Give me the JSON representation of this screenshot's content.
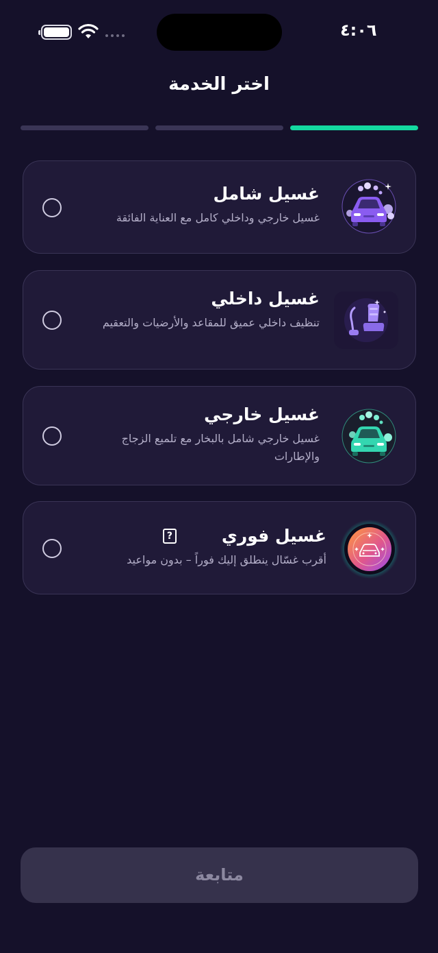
{
  "status_bar": {
    "time": "٤:٠٦"
  },
  "header": {
    "title": "اختر الخدمة"
  },
  "progress": {
    "current_step": 3,
    "total_steps": 3,
    "accent_color": "#14d9a0"
  },
  "services": [
    {
      "name": "غسيل شامل",
      "description": "غسيل خارجي وداخلي كامل مع العناية الفائقة",
      "icon": "car-foam-purple-icon",
      "selected": false
    },
    {
      "name": "غسيل داخلي",
      "description": "تنظيف داخلي عميق للمقاعد والأرضيات والتعقيم",
      "icon": "vacuum-seat-icon",
      "selected": false
    },
    {
      "name": "غسيل خارجي",
      "description": "غسيل خارجي شامل بالبخار مع تلميع الزجاج والإطارات",
      "icon": "car-foam-teal-icon",
      "selected": false
    },
    {
      "name": "غسيل فوري",
      "description": "أقرب غسّال ينطلق إليك فوراً – بدون مواعيد",
      "icon": "instant-car-icon",
      "help_icon": "help-icon",
      "selected": false
    }
  ],
  "footer": {
    "continue_label": "متابعة",
    "enabled": false
  }
}
